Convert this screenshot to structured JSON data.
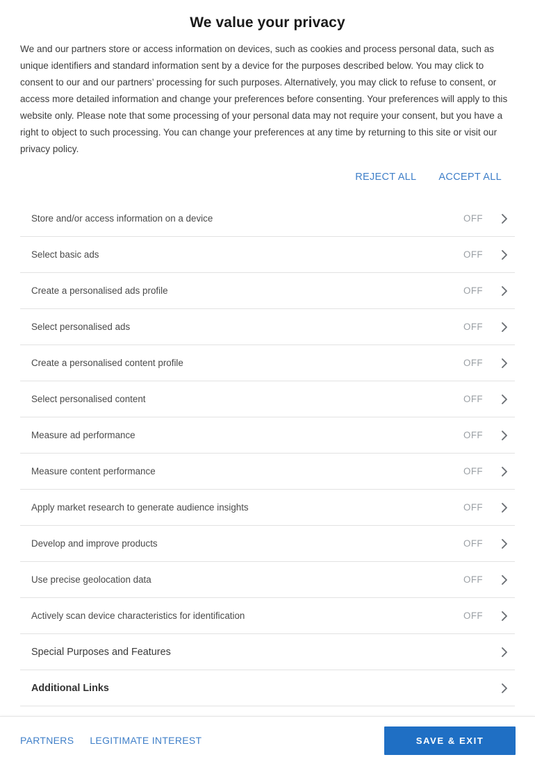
{
  "dialog": {
    "title": "We value your privacy",
    "intro": "We and our partners store or access information on devices, such as cookies and process personal data, such as unique identifiers and standard information sent by a device for the purposes described below. You may click to consent to our and our partners’ processing for such purposes. Alternatively, you may click to refuse to consent, or access more detailed information and change your preferences before consenting. Your preferences will apply to this website only. Please note that some processing of your personal data may not require your consent, but you have a right to object to such processing. You can change your preferences at any time by returning to this site or visit our privacy policy."
  },
  "top_actions": {
    "reject_all": "REJECT ALL",
    "accept_all": "ACCEPT ALL"
  },
  "purposes": [
    {
      "label": "Store and/or access information on a device",
      "state": "OFF",
      "bold": false,
      "section": false
    },
    {
      "label": "Select basic ads",
      "state": "OFF",
      "bold": false,
      "section": false
    },
    {
      "label": "Create a personalised ads profile",
      "state": "OFF",
      "bold": false,
      "section": false
    },
    {
      "label": "Select personalised ads",
      "state": "OFF",
      "bold": false,
      "section": false
    },
    {
      "label": "Create a personalised content profile",
      "state": "OFF",
      "bold": false,
      "section": false
    },
    {
      "label": "Select personalised content",
      "state": "OFF",
      "bold": false,
      "section": false
    },
    {
      "label": "Measure ad performance",
      "state": "OFF",
      "bold": false,
      "section": false
    },
    {
      "label": "Measure content performance",
      "state": "OFF",
      "bold": false,
      "section": false
    },
    {
      "label": "Apply market research to generate audience insights",
      "state": "OFF",
      "bold": false,
      "section": false
    },
    {
      "label": "Develop and improve products",
      "state": "OFF",
      "bold": false,
      "section": false
    },
    {
      "label": "Use precise geolocation data",
      "state": "OFF",
      "bold": false,
      "section": false
    },
    {
      "label": "Actively scan device characteristics for identification",
      "state": "OFF",
      "bold": false,
      "section": false
    },
    {
      "label": "Special Purposes and Features",
      "state": "",
      "bold": false,
      "section": true
    },
    {
      "label": "Additional Links",
      "state": "",
      "bold": true,
      "section": true
    }
  ],
  "footer": {
    "partners_label": "PARTNERS",
    "legitimate_interest_label": "LEGITIMATE INTEREST",
    "save_label": "SAVE & EXIT"
  },
  "colors": {
    "link_blue": "#3f7fc8",
    "button_blue": "#1f6fc4",
    "state_grey": "#9ba0a5",
    "divider": "#e2e2e2"
  },
  "icons": {
    "chevron_right": "chevron-right-icon"
  }
}
